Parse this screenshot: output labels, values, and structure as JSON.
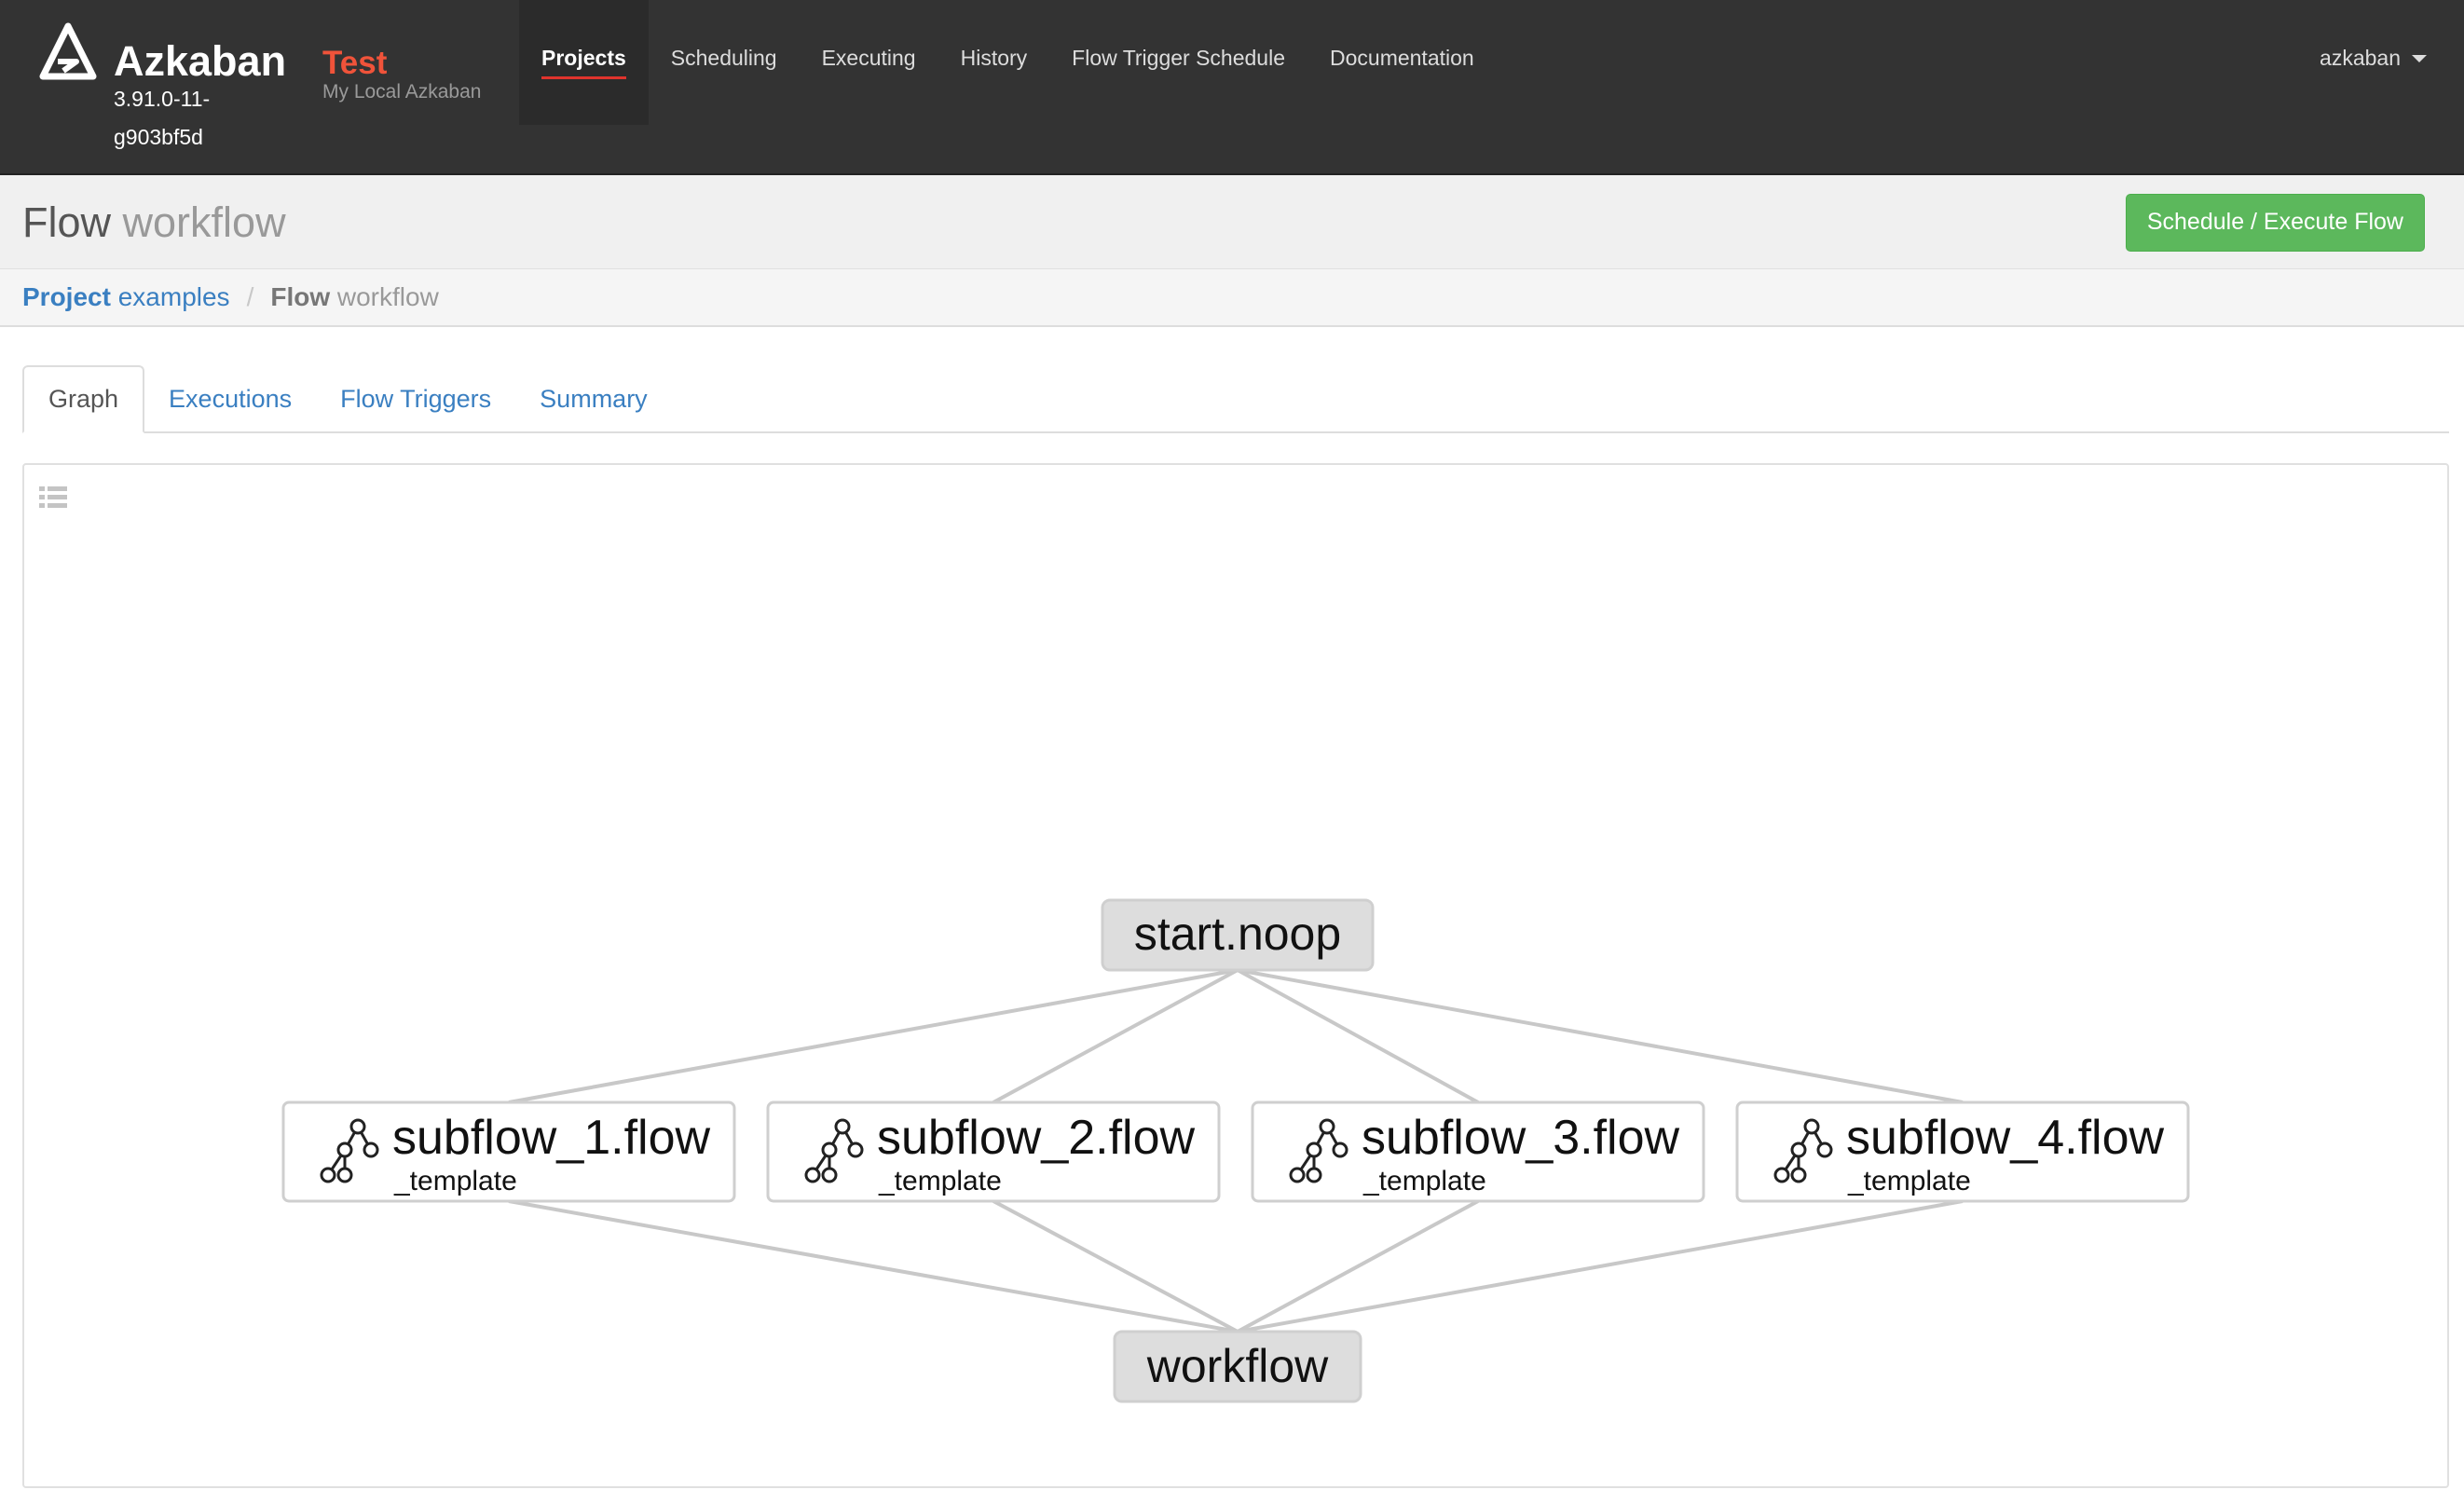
{
  "brand": {
    "name": "Azkaban",
    "version": "3.91.0-11-g903bf5d"
  },
  "environment": {
    "name": "Test",
    "description": "My Local Azkaban"
  },
  "nav": {
    "items": [
      {
        "label": "Projects",
        "active": true
      },
      {
        "label": "Scheduling"
      },
      {
        "label": "Executing"
      },
      {
        "label": "History"
      },
      {
        "label": "Flow Trigger Schedule"
      },
      {
        "label": "Documentation"
      }
    ],
    "user": "azkaban"
  },
  "header": {
    "title_keyword": "Flow",
    "title_name": "workflow",
    "execute_button": "Schedule / Execute Flow"
  },
  "breadcrumb": {
    "project_keyword": "Project",
    "project_name": "examples",
    "flow_keyword": "Flow",
    "flow_name": "workflow"
  },
  "tabs": [
    "Graph",
    "Executions",
    "Flow Triggers",
    "Summary"
  ],
  "graph": {
    "start": "start.noop",
    "subflows": [
      {
        "name": "subflow_1.flow",
        "sub": "_template"
      },
      {
        "name": "subflow_2.flow",
        "sub": "_template"
      },
      {
        "name": "subflow_3.flow",
        "sub": "_template"
      },
      {
        "name": "subflow_4.flow",
        "sub": "_template"
      }
    ],
    "end": "workflow"
  },
  "colors": {
    "navbar": "#333333",
    "accent_red": "#f0533a",
    "link_blue": "#3a7fc1",
    "success_green": "#5cb85c",
    "edge_gray": "#c8c8c8"
  }
}
